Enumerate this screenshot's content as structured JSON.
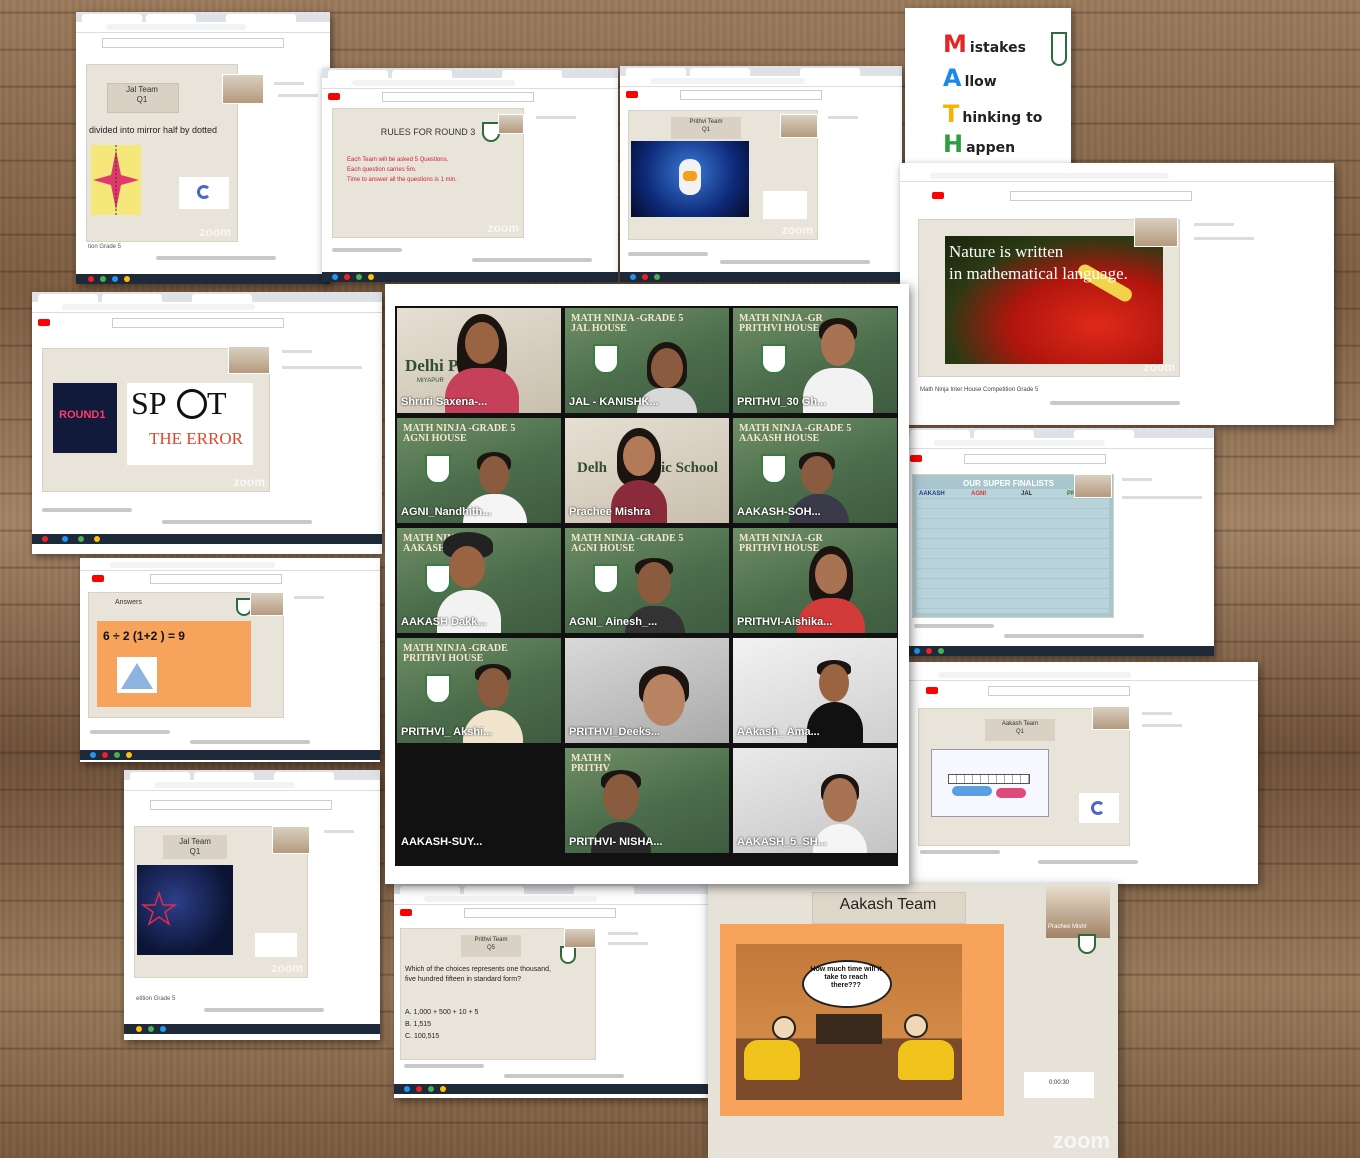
{
  "gallery": {
    "tiles": [
      {
        "name": "Shruti Saxena-...",
        "banner": "Delhi P",
        "banner2": "MIYAPUR",
        "active": true
      },
      {
        "name": "JAL - KANISHK...",
        "banner": "MATH NINJA -GRADE 5",
        "banner2": "JAL HOUSE"
      },
      {
        "name": "PRITHVI_30 Gh...",
        "banner": "MATH NINJA -GR",
        "banner2": "PRITHVI HOUSE"
      },
      {
        "name": "AGNI_Nandhith...",
        "banner": "MATH NINJA -GRADE 5",
        "banner2": "AGNI HOUSE"
      },
      {
        "name": "Prachee Mishra",
        "banner": "Delh",
        "banner2": "ic School"
      },
      {
        "name": "AAKASH-SOH...",
        "banner": "MATH NINJA -GRADE 5",
        "banner2": "AAKASH HOUSE"
      },
      {
        "name": "AAKASH Dakk...",
        "banner": "MATH NIN",
        "banner2": "AAKASH H"
      },
      {
        "name": "AGNI_ Ainesh_...",
        "banner": "MATH NINJA -GRADE 5",
        "banner2": "AGNI HOUSE"
      },
      {
        "name": "PRITHVI-Aishika...",
        "banner": "MATH NINJA -GR",
        "banner2": "PRITHVI HOUSE"
      },
      {
        "name": "PRITHVI_ Akshi...",
        "banner": "MATH NINJA -GRADE",
        "banner2": "PRITHVI HOUSE"
      },
      {
        "name": "PRITHVI_Deeks...",
        "banner": "",
        "banner2": ""
      },
      {
        "name": "AAkash_ Ama...",
        "banner": "",
        "banner2": ""
      },
      {
        "name": "AAKASH-SUY...",
        "banner": "",
        "banner2": ""
      },
      {
        "name": "PRITHVI- NISHA...",
        "banner": "MATH N",
        "banner2": "PRITHV"
      },
      {
        "name": "AAKASH_5_SH...",
        "banner": "",
        "banner2": ""
      }
    ]
  },
  "shot_jal_q1": {
    "team": "Jal Team",
    "q": "Q1",
    "text": "divided into mirror half by dotted",
    "footer": "tion Grade 5"
  },
  "shot_rules": {
    "title": "RULES FOR ROUND 3",
    "rules": [
      "Each Team will be asked 5 Questions.",
      "Each question carries 5m.",
      "Time to answer all the questions is 1 min."
    ]
  },
  "shot_prithvi_q1": {
    "team": "Prithvi Team",
    "q": "Q1"
  },
  "math_poster": {
    "rows": [
      {
        "letter": "M",
        "rest": "istakes",
        "color": "#e32626"
      },
      {
        "letter": "A",
        "rest": "llow",
        "color": "#1e88e5"
      },
      {
        "letter": "T",
        "rest": "hinking to",
        "color": "#f4b400"
      },
      {
        "letter": "H",
        "rest": "appen",
        "color": "#2e9e43"
      }
    ]
  },
  "shot_nature": {
    "line1": "Nature is written",
    "line2": "in mathematical language.",
    "footer": "Math Ninja Inter House Competition Grade 5"
  },
  "shot_spot": {
    "round": "ROUND1",
    "word1": "SP",
    "word2": "T",
    "word3": "THE ERROR"
  },
  "shot_score": {
    "title": "OUR SUPER FINALISTS",
    "cols": [
      "AAKASH",
      "AGNI",
      "JAL",
      "PRITHVI"
    ]
  },
  "shot_answers": {
    "title": "Answers",
    "equation": "6 ÷ 2 (1+2 ) = 9"
  },
  "shot_aakash_q1": {
    "team": "Aakash Team",
    "q": "Q1"
  },
  "shot_jal_star": {
    "team": "Jal Team",
    "q": "Q1",
    "footer": "etition Grade 5"
  },
  "shot_prithvi_q5": {
    "team": "Prithvi Team",
    "q": "Q5",
    "question": "Which of the choices represents one thousand, five hundred fifteen in standard form?",
    "options": [
      "A. 1,000 + 500 + 10 + 5",
      "B. 1,515",
      "C. 100,515"
    ]
  },
  "aakash_big": {
    "title": "Aakash Team",
    "bubble": "How much time will it take to reach there???",
    "host": "Prachee Mishr",
    "zoom": "zoom",
    "timer": "0:00:30"
  },
  "zoom_watermark": "zoom"
}
